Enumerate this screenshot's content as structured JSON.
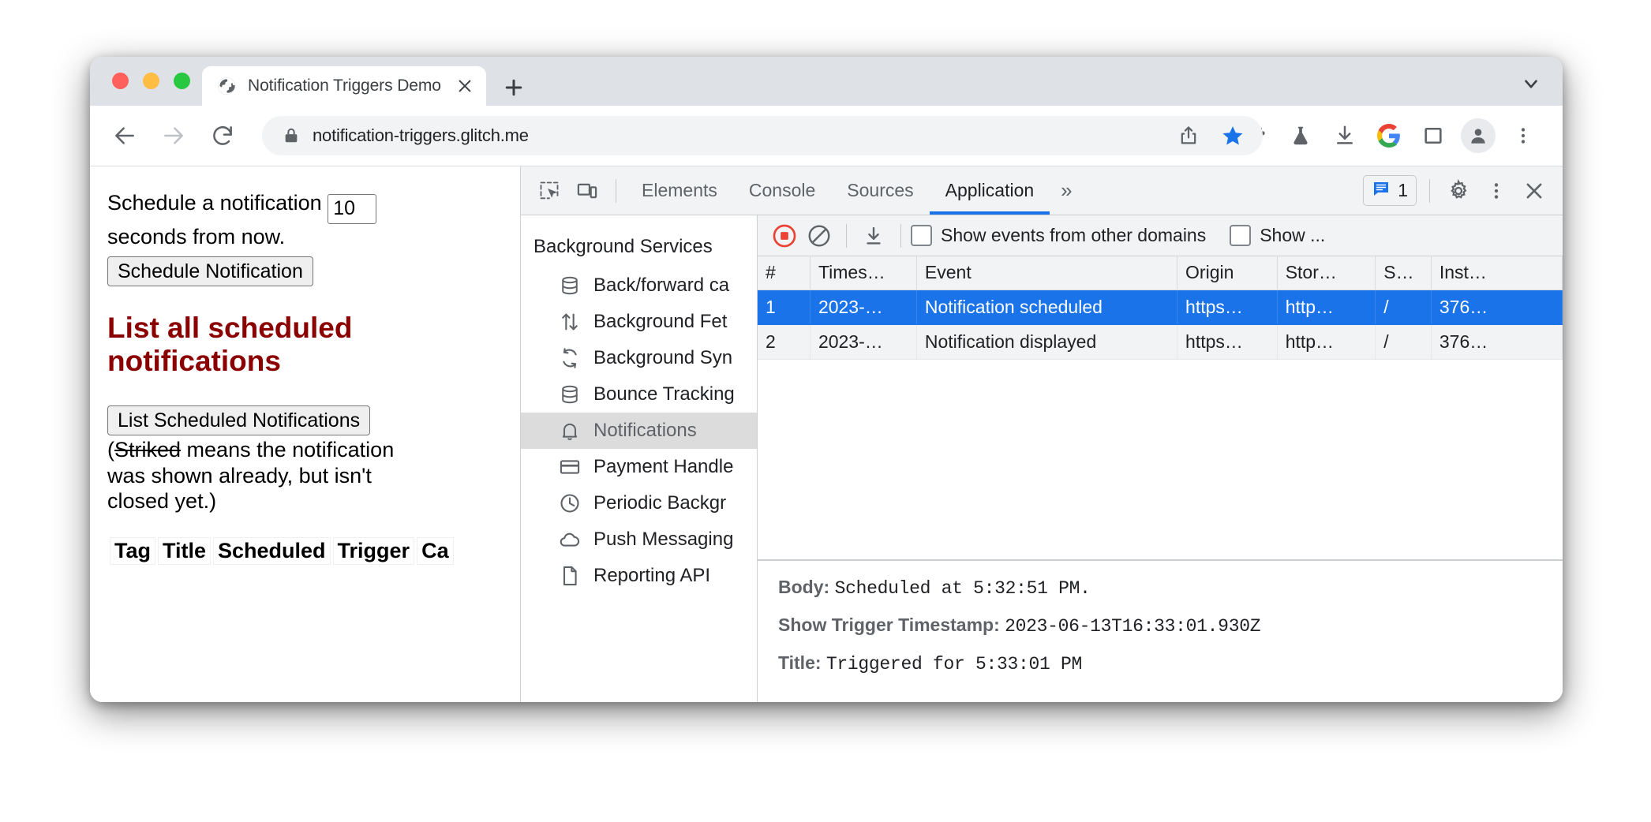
{
  "browser": {
    "tab": {
      "title": "Notification Triggers Demo",
      "favicon_icon": "globe-icon",
      "close_icon": "close-icon"
    },
    "new_tab_icon": "plus-icon",
    "tabstrip_chevron_icon": "chevron-down-icon",
    "nav": {
      "back_icon": "arrow-left-icon",
      "forward_icon": "arrow-right-icon",
      "reload_icon": "reload-icon"
    },
    "omnibox": {
      "lock_icon": "lock-icon",
      "url": "notification-triggers.glitch.me"
    },
    "toolbar_icons": [
      "share-icon",
      "bookmark-star-icon",
      "extensions-puzzle-icon",
      "labs-flask-icon",
      "downloads-icon",
      "google-icon",
      "side-panel-icon",
      "profile-avatar-icon",
      "chrome-menu-icon"
    ]
  },
  "page": {
    "schedule_text_before": "Schedule a notification",
    "seconds_value": "10",
    "schedule_text_after": "seconds from now.",
    "schedule_button": "Schedule Notification",
    "heading": "List all scheduled notifications",
    "list_button": "List Scheduled Notifications",
    "note_open_paren": "(",
    "note_struck": "Striked",
    "note_rest": " means the notification was shown already, but isn't closed yet.)",
    "table_headers": [
      "Tag",
      "Title",
      "Scheduled",
      "Trigger",
      "Ca"
    ]
  },
  "devtools": {
    "inspect_icon": "inspect-element-icon",
    "device_icon": "device-toolbar-icon",
    "tabs": [
      {
        "label": "Elements",
        "active": false
      },
      {
        "label": "Console",
        "active": false
      },
      {
        "label": "Sources",
        "active": false
      },
      {
        "label": "Application",
        "active": true
      }
    ],
    "more_tabs_icon": "chevron-double-right-icon",
    "issues": {
      "icon": "issues-message-icon",
      "count": "1"
    },
    "settings_icon": "gear-icon",
    "kebab_icon": "more-vertical-icon",
    "close_icon": "close-icon",
    "sidebar": {
      "section_title": "Background Services",
      "items": [
        {
          "label": "Back/forward ca",
          "icon": "database-icon",
          "selected": false
        },
        {
          "label": "Background Fet",
          "icon": "arrows-up-down-icon",
          "selected": false
        },
        {
          "label": "Background Syn",
          "icon": "sync-icon",
          "selected": false
        },
        {
          "label": "Bounce Tracking",
          "icon": "database-icon",
          "selected": false
        },
        {
          "label": "Notifications",
          "icon": "bell-icon",
          "selected": true
        },
        {
          "label": "Payment Handle",
          "icon": "credit-card-icon",
          "selected": false
        },
        {
          "label": "Periodic Backgr",
          "icon": "clock-icon",
          "selected": false
        },
        {
          "label": "Push Messaging",
          "icon": "cloud-icon",
          "selected": false
        },
        {
          "label": "Reporting API",
          "icon": "document-icon",
          "selected": false
        }
      ]
    },
    "main_toolbar": {
      "record_icon": "record-stop-icon",
      "clear_icon": "clear-no-entry-icon",
      "download_icon": "download-icon",
      "checkbox_other_domains": "Show events from other domains",
      "checkbox_truncated": "Show ..."
    },
    "events_table": {
      "headers": [
        "#",
        "Times…",
        "Event",
        "Origin",
        "Stor…",
        "S…",
        "Inst…"
      ],
      "rows": [
        {
          "selected": true,
          "cells": [
            "1",
            "2023-…",
            "Notification scheduled",
            "https…",
            "http…",
            "/",
            "376…"
          ]
        },
        {
          "selected": false,
          "cells": [
            "2",
            "2023-…",
            "Notification displayed",
            "https…",
            "http…",
            "/",
            "376…"
          ]
        }
      ]
    },
    "detail": [
      {
        "key": "Body:",
        "value": "Scheduled at 5:32:51 PM."
      },
      {
        "key": "Show Trigger Timestamp:",
        "value": "2023-06-13T16:33:01.930Z"
      },
      {
        "key": "Title:",
        "value": "Triggered for 5:33:01 PM"
      }
    ]
  },
  "colors": {
    "accent_blue": "#1a73e8",
    "heading_red": "#8b0000",
    "record_red": "#ea4335",
    "chrome_gray": "#dee1e6"
  }
}
